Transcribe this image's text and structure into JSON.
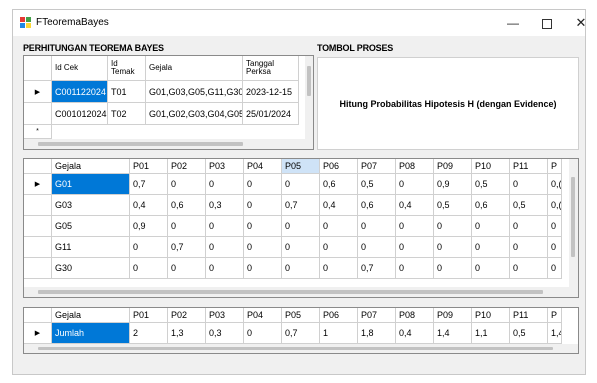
{
  "window": {
    "title": "FTeoremaBayes",
    "minimize_glyph": "—",
    "close_glyph": "✕"
  },
  "sections": {
    "perhitungan_label": "PERHITUNGAN TEOREMA BAYES",
    "tombol_label": "TOMBOL PROSES"
  },
  "button": {
    "label": "Hitung Probabilitas Hipotesis H (dengan Evidence)"
  },
  "top_grid": {
    "columns": [
      "Id Cek",
      "Id Temak",
      "Gejala",
      "Tanggal Perksa"
    ],
    "columns_split": [
      [
        "Id Cek"
      ],
      [
        "Id",
        "Temak"
      ],
      [
        "Gejala"
      ],
      [
        "Tanggal",
        "Perksa"
      ]
    ],
    "rows": [
      [
        "C001122024",
        "T01",
        "G01,G03,G05,G11,G30",
        "2023-12-15"
      ],
      [
        "C001012024",
        "T02",
        "G01,G02,G03,G04,G05",
        "25/01/2024"
      ]
    ],
    "current_row_marker": "▶",
    "new_row_marker": "*"
  },
  "mid_grid": {
    "columns": [
      "Gejala",
      "P01",
      "P02",
      "P03",
      "P04",
      "P05",
      "P06",
      "P07",
      "P08",
      "P09",
      "P10",
      "P11",
      "P"
    ],
    "rows": [
      [
        "G01",
        "0,7",
        "0",
        "0",
        "0",
        "0",
        "0,6",
        "0,5",
        "0",
        "0,9",
        "0,5",
        "0",
        "0,("
      ],
      [
        "G03",
        "0,4",
        "0,6",
        "0,3",
        "0",
        "0,7",
        "0,4",
        "0,6",
        "0,4",
        "0,5",
        "0,6",
        "0,5",
        "0,("
      ],
      [
        "G05",
        "0,9",
        "0",
        "0",
        "0",
        "0",
        "0",
        "0",
        "0",
        "0",
        "0",
        "0",
        "0"
      ],
      [
        "G11",
        "0",
        "0,7",
        "0",
        "0",
        "0",
        "0",
        "0",
        "0",
        "0",
        "0",
        "0",
        "0"
      ],
      [
        "G30",
        "0",
        "0",
        "0",
        "0",
        "0",
        "0",
        "0,7",
        "0",
        "0",
        "0",
        "0",
        "0"
      ]
    ],
    "current_row_marker": "▶"
  },
  "bottom_grid": {
    "columns": [
      "Gejala",
      "P01",
      "P02",
      "P03",
      "P04",
      "P05",
      "P06",
      "P07",
      "P08",
      "P09",
      "P10",
      "P11",
      "P"
    ],
    "rows": [
      [
        "Jumlah",
        "2",
        "1,3",
        "0,3",
        "0",
        "0,7",
        "1",
        "1,8",
        "0,4",
        "1,4",
        "1,1",
        "0,5",
        "1,4"
      ]
    ],
    "current_row_marker": "▶"
  },
  "colors": {
    "selection": "#0078d7",
    "header_highlight": "#cfe3f7",
    "window_bg": "#f0f0f0"
  }
}
